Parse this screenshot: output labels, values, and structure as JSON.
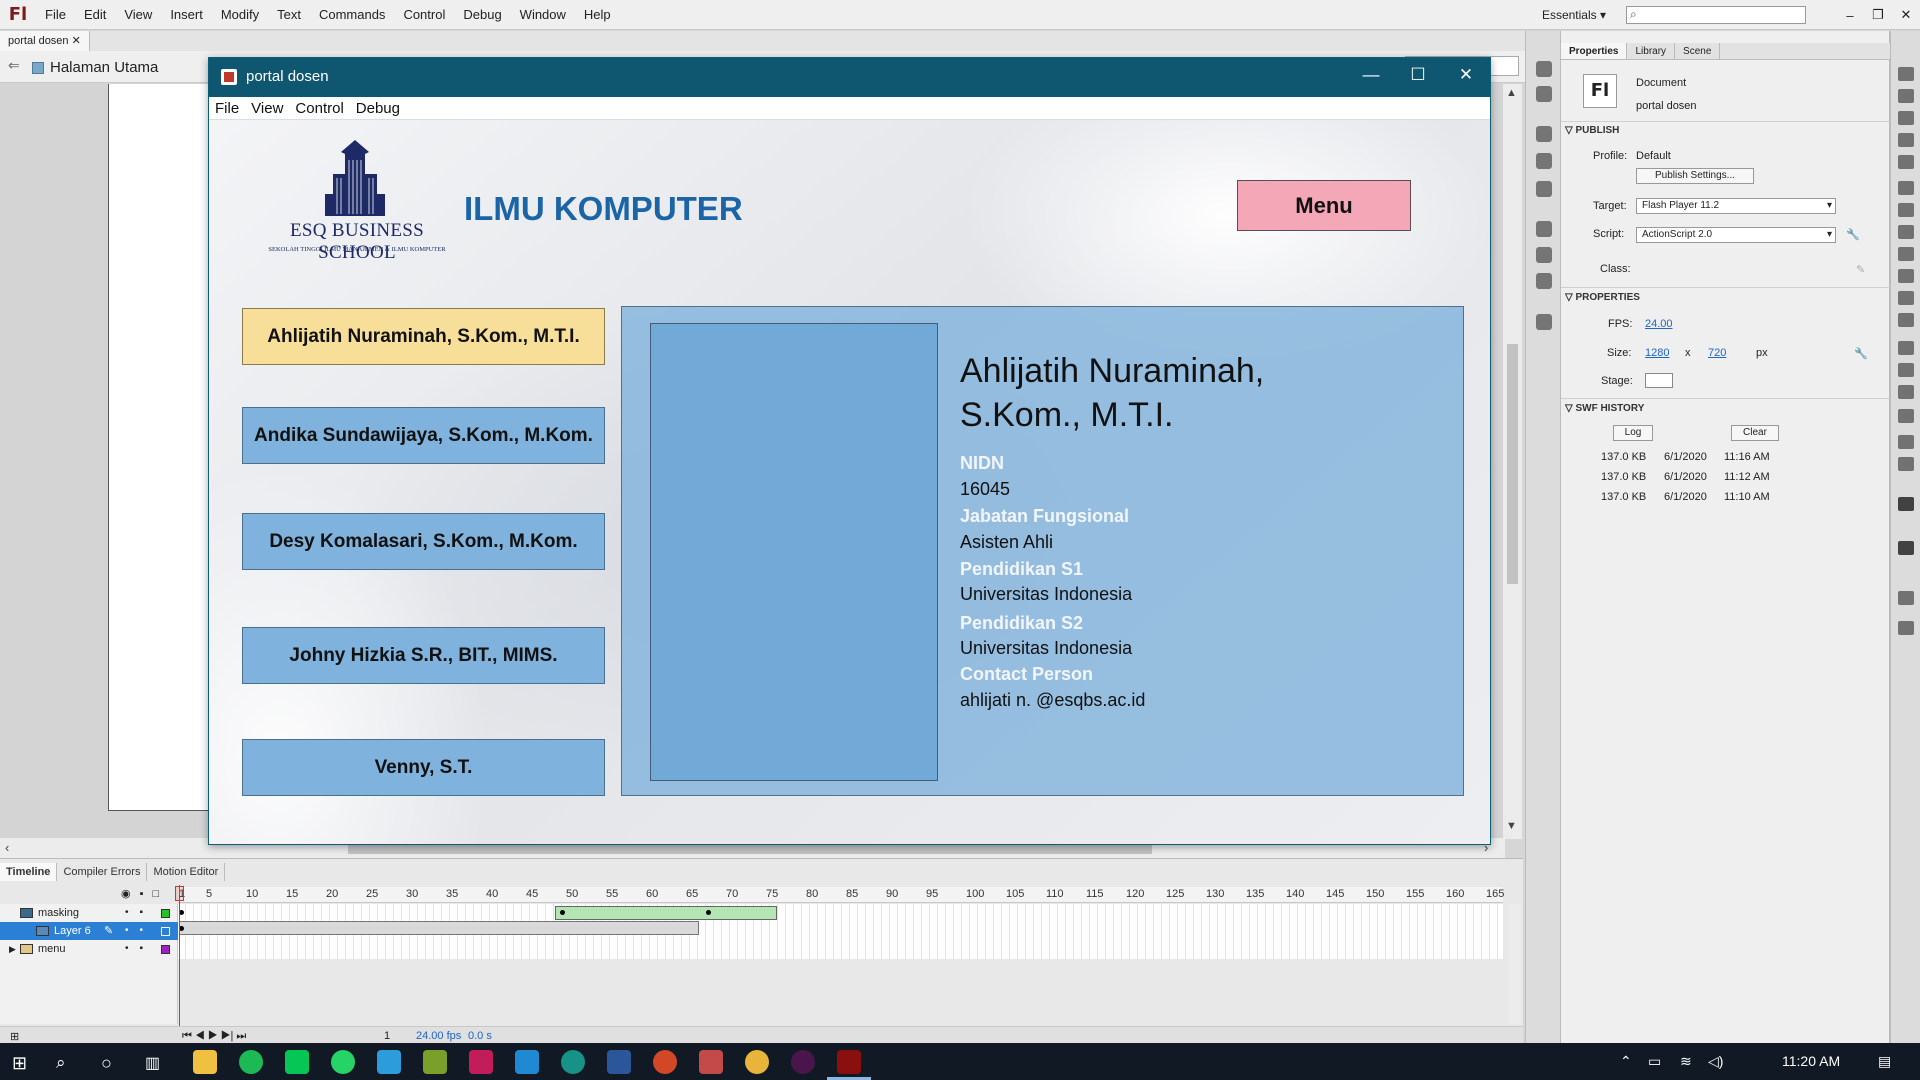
{
  "app": {
    "logo": "Fl",
    "menus": [
      "File",
      "Edit",
      "View",
      "Insert",
      "Modify",
      "Text",
      "Commands",
      "Control",
      "Debug",
      "Window",
      "Help"
    ],
    "workspace": "Essentials",
    "search_placeholder": "",
    "doc_tab": "portal dosen",
    "scene_name": "Halaman Utama"
  },
  "swf_window": {
    "title": "portal dosen",
    "menus": [
      "File",
      "View",
      "Control",
      "Debug"
    ],
    "logo_school": "ESQ BUSINESS SCHOOL",
    "logo_tagline": "SEKOLAH TINGGI ILMU MANAJEMEN & ILMU KOMPUTER",
    "department": "ILMU KOMPUTER",
    "menu_button": "Menu",
    "lecturers": [
      "Ahlijatih Nuraminah, S.Kom., M.T.I.",
      "Andika Sundawijaya, S.Kom., M.Kom.",
      "Desy Komalasari, S.Kom., M.Kom.",
      "Johny Hizkia S.R., BIT., MIMS.",
      "Venny, S.T."
    ],
    "selected_index": 0,
    "detail": {
      "name_line1": "Ahlijatih Nuraminah,",
      "name_line2": "S.Kom., M.T.I.",
      "nidn_label": "NIDN",
      "nidn": "16045",
      "jabatan_label": "Jabatan Fungsional",
      "jabatan": "Asisten Ahli",
      "s1_label": "Pendidikan S1",
      "s1": "Universitas Indonesia",
      "s2_label": "Pendidikan S2",
      "s2": "Universitas Indonesia",
      "contact_label": "Contact Person",
      "contact": "ahlijati n. @esqbs.ac.id"
    }
  },
  "timeline": {
    "tabs": [
      "Timeline",
      "Compiler Errors",
      "Motion Editor"
    ],
    "ruler": [
      "1",
      "5",
      "10",
      "15",
      "20",
      "25",
      "30",
      "35",
      "40",
      "45",
      "50",
      "55",
      "60",
      "65",
      "70",
      "75",
      "80",
      "85",
      "90",
      "95",
      "100",
      "105",
      "110",
      "115",
      "120",
      "125",
      "130",
      "135",
      "140",
      "145",
      "150",
      "155",
      "160",
      "165"
    ],
    "layers": [
      "masking",
      "Layer 6",
      "menu"
    ],
    "selected_layer": "Layer 6",
    "current_frame": "1",
    "fps": "24.00 fps",
    "time": "0.0 s"
  },
  "properties": {
    "tabs": [
      "Properties",
      "Library",
      "Scene"
    ],
    "doc_type": "Document",
    "doc_name": "portal dosen",
    "publish_section": "PUBLISH",
    "profile_label": "Profile:",
    "profile": "Default",
    "publish_settings": "Publish Settings...",
    "target_label": "Target:",
    "target": "Flash Player 11.2",
    "script_label": "Script:",
    "script": "ActionScript 2.0",
    "class_label": "Class:",
    "properties_section": "PROPERTIES",
    "fps_label": "FPS:",
    "fps": "24.00",
    "size_label": "Size:",
    "width": "1280",
    "x": "x",
    "height": "720",
    "unit": "px",
    "stage_label": "Stage:",
    "stage_color": "#ffffff",
    "swf_history_section": "SWF HISTORY",
    "log_button": "Log",
    "clear_button": "Clear",
    "history": [
      {
        "size": "137.0 KB",
        "date": "6/1/2020",
        "time": "11:16 AM"
      },
      {
        "size": "137.0 KB",
        "date": "6/1/2020",
        "time": "11:12 AM"
      },
      {
        "size": "137.0 KB",
        "date": "6/1/2020",
        "time": "11:10 AM"
      }
    ]
  },
  "taskbar": {
    "clock": "11:20 AM",
    "apps": [
      "file-explorer",
      "spotify",
      "line",
      "whatsapp",
      "app-blue",
      "lambda",
      "jetbrains",
      "vscode",
      "gitkraken",
      "word",
      "powerpoint",
      "paint",
      "chrome",
      "slack",
      "flash"
    ]
  },
  "colors": {
    "titlebar": "#0f5670",
    "lecturer_button": "#7fb2dc",
    "lecturer_active": "#f7df9a",
    "menu_button": "#f4a7b6",
    "department": "#1b64a6",
    "detail_label": "#f2f6fb"
  }
}
